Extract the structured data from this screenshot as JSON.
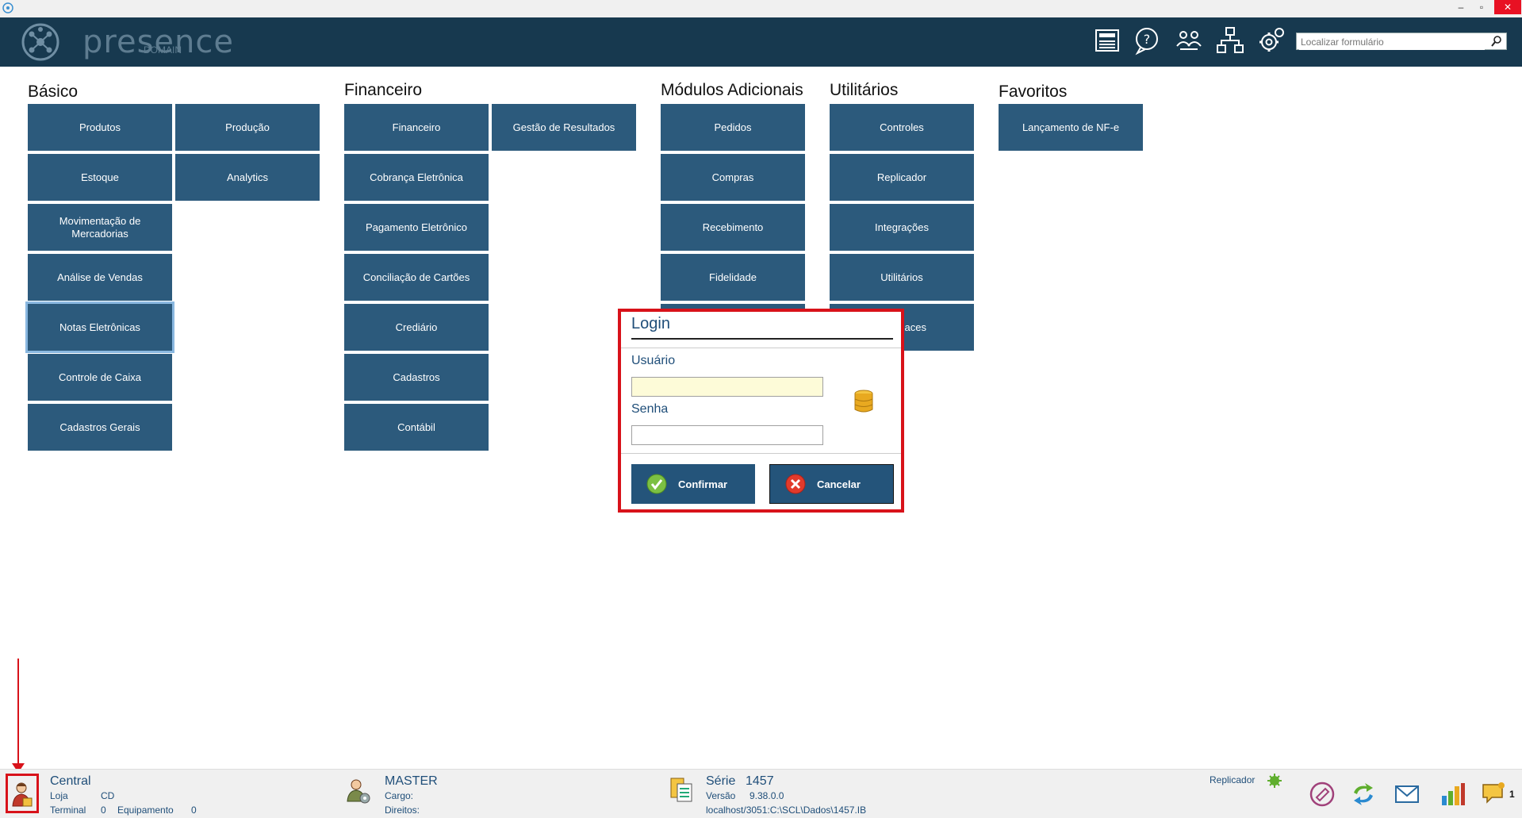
{
  "window": {
    "minimize": "–",
    "restore": "▫",
    "close": "✕"
  },
  "header": {
    "logo_main": "presence",
    "logo_sub": "DOMAIN",
    "search_placeholder": "Localizar formulário",
    "icons": [
      "news-icon",
      "help-icon",
      "users-icon",
      "network-icon",
      "settings-icon"
    ]
  },
  "sections": {
    "basico": {
      "title": "Básico",
      "tiles": [
        "Produtos",
        "Produção",
        "Estoque",
        "Analytics",
        "Movimentação de Mercadorias",
        "Análise de Vendas",
        "Notas Eletrônicas",
        "Controle de Caixa",
        "Cadastros Gerais"
      ]
    },
    "financeiro": {
      "title": "Financeiro",
      "tiles": [
        "Financeiro",
        "Gestão de Resultados",
        "Cobrança Eletrônica",
        "Pagamento Eletrônico",
        "Conciliação de Cartões",
        "Crediário",
        "Cadastros",
        "Contábil"
      ]
    },
    "modulos": {
      "title": "Módulos Adicionais",
      "tiles": [
        "Pedidos",
        "Compras",
        "Recebimento",
        "Fidelidade"
      ]
    },
    "utilitarios": {
      "title": "Utilitários",
      "tiles": [
        "Controles",
        "Replicador",
        "Integrações",
        "Utilitários",
        "aces"
      ]
    },
    "favoritos": {
      "title": "Favoritos",
      "tiles": [
        "Lançamento de NF-e"
      ]
    }
  },
  "login": {
    "title": "Login",
    "user_label": "Usuário",
    "user_value": "",
    "password_label": "Senha",
    "password_value": "",
    "confirm": "Confirmar",
    "cancel": "Cancelar"
  },
  "status": {
    "store_name": "Central",
    "loja_label": "Loja",
    "loja_value": "CD",
    "terminal_label": "Terminal",
    "terminal_value": "0",
    "equip_label": "Equipamento",
    "equip_value": "0",
    "user_name": "MASTER",
    "cargo_label": "Cargo:",
    "direitos_label": "Direitos:",
    "serie_label": "Série",
    "serie_value": "1457",
    "versao_label": "Versão",
    "versao_value": "9.38.0.0",
    "db_path": "localhost/3051:C:\\SCL\\Dados\\1457.IB",
    "replicador": "Replicador",
    "notif_count": "1",
    "replicador_status_color": "#5fae2e"
  }
}
